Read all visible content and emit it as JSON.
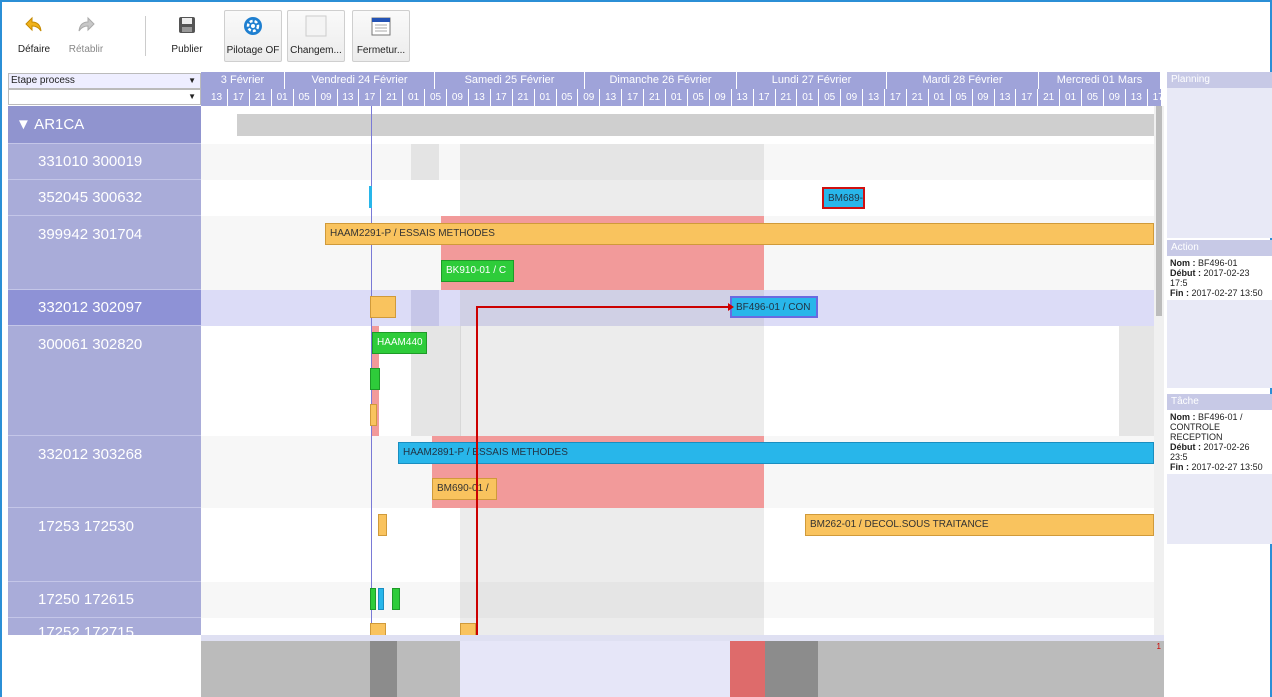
{
  "toolbar": {
    "undo": "Défaire",
    "redo": "Rétablir",
    "publish": "Publier",
    "pilotage": "Pilotage OF",
    "change": "Changem...",
    "close": "Fermetur..."
  },
  "filters": {
    "process_step": "Etape process",
    "second": ""
  },
  "timeline": {
    "days": [
      "3 Février",
      "Vendredi 24 Février",
      "Samedi 25 Février",
      "Dimanche 26 Février",
      "Lundi 27 Février",
      "Mardi 28 Février",
      "Mercredi 01 Mars"
    ],
    "hours": [
      "13",
      "17",
      "21",
      "01",
      "05",
      "09",
      "13",
      "17",
      "21",
      "01",
      "05",
      "09",
      "13",
      "17",
      "21",
      "01",
      "05",
      "09",
      "13",
      "17",
      "21",
      "01",
      "05",
      "09",
      "13",
      "17",
      "21",
      "01",
      "05",
      "09",
      "13",
      "17",
      "21",
      "01",
      "05",
      "09",
      "13",
      "17",
      "21",
      "01",
      "05",
      "09",
      "13",
      "17"
    ]
  },
  "rows": {
    "group": "▼ AR1CA",
    "r1": "331010 300019",
    "r2": "352045 300632",
    "r3": "399942 301704",
    "r4": "332012 302097",
    "r5": "300061 302820",
    "r6": "332012 303268",
    "r7": "17253 172530",
    "r8": "17250 172615",
    "r9": "17252 172715"
  },
  "bars": {
    "bm689": "BM689-",
    "haam2291": "HAAM2291-P / ESSAIS METHODES",
    "bk910": "BK910-01 / C",
    "bf496": "BF496-01 / CON",
    "haam440": "HAAM440",
    "haam2891": "HAAM2891-P / ESSAIS METHODES",
    "bm690": "BM690-01 /",
    "bm262": "BM262-01 / DECOL.SOUS TRAITANCE"
  },
  "overview_marker": "1",
  "panels": {
    "planning": {
      "title": "Planning"
    },
    "action": {
      "title": "Action",
      "nom_label": "Nom :",
      "nom": "BF496-01",
      "debut_label": "Début :",
      "debut": "2017-02-23 17:5",
      "fin_label": "Fin :",
      "fin": "2017-02-27 13:50"
    },
    "tache": {
      "title": "Tâche",
      "nom_label": "Nom :",
      "nom": "BF496-01 / CONTROLE RECEPTION",
      "debut_label": "Début :",
      "debut": "2017-02-26 23:5",
      "fin_label": "Fin :",
      "fin": "2017-02-27 13:50"
    }
  },
  "colors": {
    "accent": "#2b8fd6",
    "header": "#9fa3d9",
    "row": "#a9acd9",
    "orange": "#f9c35e",
    "green": "#2ecc3a",
    "blue": "#28b6ea",
    "red_zone": "#f29a9a",
    "link": "#cc0000"
  }
}
